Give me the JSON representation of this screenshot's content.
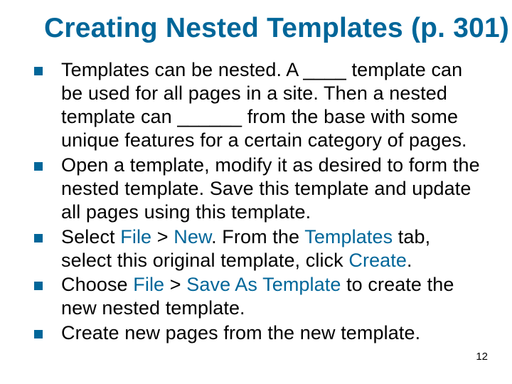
{
  "title": "Creating Nested Templates (p. 301)",
  "slide_number": "12",
  "bullets": {
    "b0": {
      "t0": "Templates can be nested. A ____ template can be used for all pages in a site. Then a nested template can ______ from the base with some unique features for a certain category of pages."
    },
    "b1": {
      "t0": "Open a template, modify it as desired to form the nested template. Save this template and update all pages using this template."
    },
    "b2": {
      "t0": "Select ",
      "h0": "File",
      "t1": " > ",
      "h1": "New",
      "t2": ". From the ",
      "h2": "Templates",
      "t3": " tab, select this original template, click ",
      "h3": "Create",
      "t4": "."
    },
    "b3": {
      "t0": "Choose ",
      "h0": "File",
      "t1": " > ",
      "h1": "Save As Template",
      "t2": " to create the new nested template."
    },
    "b4": {
      "t0": "Create new pages from the new template."
    }
  }
}
